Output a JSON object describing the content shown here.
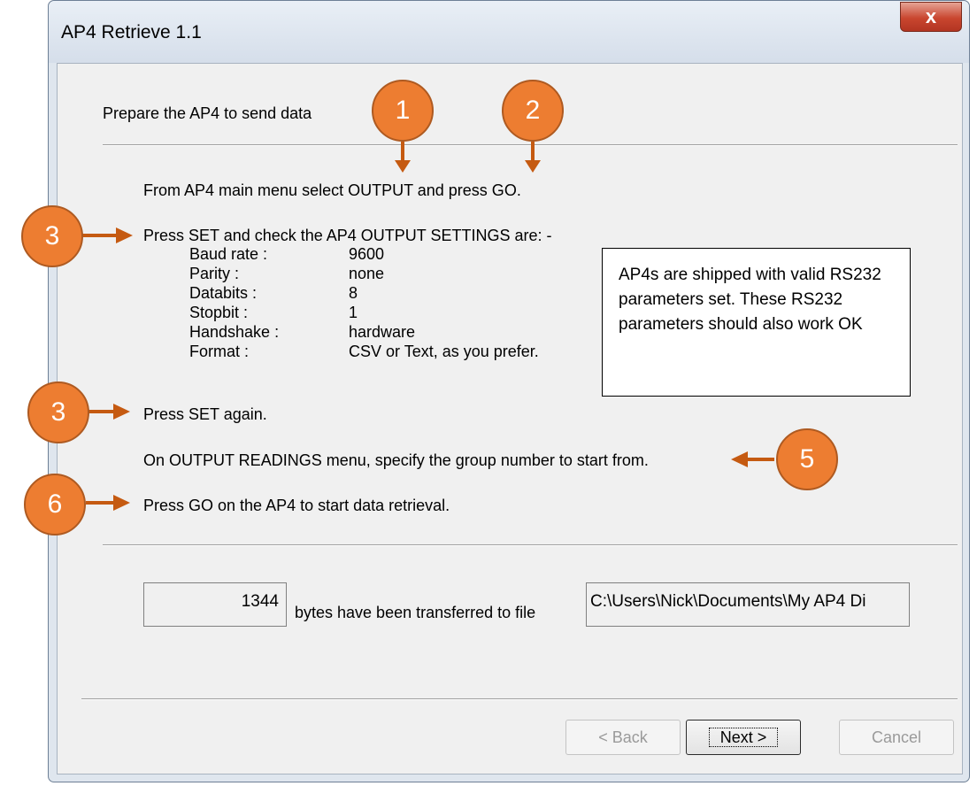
{
  "window": {
    "title": "AP4 Retrieve 1.1",
    "close_glyph": "x"
  },
  "header": {
    "instruction": "Prepare the AP4 to send data"
  },
  "steps": {
    "step1": "From AP4 main menu select OUTPUT and press GO.",
    "step2": "Press SET and check the AP4 OUTPUT SETTINGS are: -",
    "step3": "Press SET again.",
    "step4": "On OUTPUT READINGS menu, specify the group number to start from.",
    "step5": "Press GO on the AP4 to start data retrieval."
  },
  "settings": [
    {
      "label": "Baud rate :",
      "value": "9600"
    },
    {
      "label": "Parity :",
      "value": "none"
    },
    {
      "label": "Databits :",
      "value": "8"
    },
    {
      "label": "Stopbit :",
      "value": "1"
    },
    {
      "label": "Handshake :",
      "value": "hardware"
    },
    {
      "label": "Format :",
      "value": "CSV or Text, as you prefer."
    }
  ],
  "transfer": {
    "bytes": "1344",
    "bytes_label": "bytes have been transferred to file",
    "file_path": "C:\\Users\\Nick\\Documents\\My AP4 Di"
  },
  "buttons": {
    "back": "< Back",
    "next": "Next >",
    "cancel": "Cancel"
  },
  "annotations": {
    "circles": [
      "1",
      "2",
      "3",
      "3",
      "5",
      "6"
    ],
    "callout": "AP4s are shipped with valid RS232 parameters set. These RS232 parameters should also work OK",
    "color": "#ed7d31",
    "arrow_color": "#c55a11"
  },
  "colors": {
    "window_frame": "#dfe6ee",
    "client_bg": "#f0f0f0",
    "close_button": "#c9462f"
  }
}
